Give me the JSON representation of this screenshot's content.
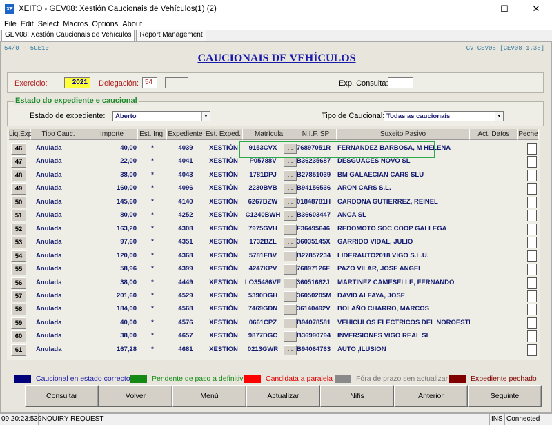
{
  "window": {
    "title": "XEITO - GEV08: Xestión Caucionais de Vehículos(1) (2)",
    "app_icon_text": "XE",
    "controls": {
      "minimize": "—",
      "maximize": "☐",
      "close": "✕"
    }
  },
  "menu": [
    "File",
    "Edit",
    "Select",
    "Macros",
    "Options",
    "About"
  ],
  "tabs": [
    "GEV08: Xestión Caucionais de Vehículos",
    "Report Management"
  ],
  "header": {
    "code_left": "54/0 - 5GE10",
    "code_right": "GV-GEV08 [GEV08 1.38]",
    "title": "CAUCIONAIS DE VEHÍCULOS"
  },
  "filters": {
    "exercicio_label": "Exercicio:",
    "exercicio_value": "2021",
    "delegacion_label": "Delegación:",
    "delegacion_value": "54",
    "delegacion_extra": "",
    "exp_consulta_label": "Exp. Consulta:",
    "exp_consulta_value": ""
  },
  "estado": {
    "legend": "Estado do expediente  e caucional",
    "estado_label": "Estado de expediente:",
    "estado_value": "Aberto",
    "tipo_label": "Tipo de Caucional:",
    "tipo_value": "Todas as caucionais"
  },
  "columns": [
    "Liq.Exp.",
    "Tipo Cauc.",
    "Importe",
    "Est. Ing.",
    "Expediente",
    "Est. Exped.",
    "Matrícula",
    "N.I.F. SP",
    "Suxeito Pasivo",
    "Act. Datos",
    "Peche"
  ],
  "rows": [
    {
      "n": "46",
      "tipo": "Anulada",
      "importe": "40,00",
      "est": "*",
      "exp": "4039",
      "estexp": "XESTIÓN",
      "mat": "9153CVX",
      "nif": "76897051R",
      "suxeito": "FERNANDEZ BARBOSA, M HELENA"
    },
    {
      "n": "47",
      "tipo": "Anulada",
      "importe": "22,00",
      "est": "*",
      "exp": "4041",
      "estexp": "XESTIÓN",
      "mat": "P05788V",
      "nif": "B36235687",
      "suxeito": "DESGUACES NOVO SL"
    },
    {
      "n": "48",
      "tipo": "Anulada",
      "importe": "38,00",
      "est": "*",
      "exp": "4043",
      "estexp": "XESTIÓN",
      "mat": "1781DPJ",
      "nif": "B27851039",
      "suxeito": "BM GALAECIAN CARS SLU"
    },
    {
      "n": "49",
      "tipo": "Anulada",
      "importe": "160,00",
      "est": "*",
      "exp": "4096",
      "estexp": "XESTIÓN",
      "mat": "2230BVB",
      "nif": "B94156536",
      "suxeito": "ARON CARS S.L."
    },
    {
      "n": "50",
      "tipo": "Anulada",
      "importe": "145,60",
      "est": "*",
      "exp": "4140",
      "estexp": "XESTIÓN",
      "mat": "6267BZW",
      "nif": "01848781H",
      "suxeito": "CARDONA GUTIERREZ, REINEL"
    },
    {
      "n": "51",
      "tipo": "Anulada",
      "importe": "80,00",
      "est": "*",
      "exp": "4252",
      "estexp": "XESTIÓN",
      "mat": "C1240BWH",
      "nif": "B36603447",
      "suxeito": "ANCA SL"
    },
    {
      "n": "52",
      "tipo": "Anulada",
      "importe": "163,20",
      "est": "*",
      "exp": "4308",
      "estexp": "XESTIÓN",
      "mat": "7975GVH",
      "nif": "F36495646",
      "suxeito": "REDOMOTO SOC COOP GALLEGA"
    },
    {
      "n": "53",
      "tipo": "Anulada",
      "importe": "97,60",
      "est": "*",
      "exp": "4351",
      "estexp": "XESTIÓN",
      "mat": "1732BZL",
      "nif": "36035145X",
      "suxeito": "GARRIDO VIDAL, JULIO"
    },
    {
      "n": "54",
      "tipo": "Anulada",
      "importe": "120,00",
      "est": "*",
      "exp": "4368",
      "estexp": "XESTIÓN",
      "mat": "5781FBV",
      "nif": "B27857234",
      "suxeito": "LIDERAUTO2018 VIGO S.L.U."
    },
    {
      "n": "55",
      "tipo": "Anulada",
      "importe": "58,96",
      "est": "*",
      "exp": "4399",
      "estexp": "XESTIÓN",
      "mat": "4247KPV",
      "nif": "76897126F",
      "suxeito": "PAZO VILAR, JOSE ANGEL"
    },
    {
      "n": "56",
      "tipo": "Anulada",
      "importe": "38,00",
      "est": "*",
      "exp": "4449",
      "estexp": "XESTIÓN",
      "mat": "LO35486VE",
      "nif": "36051662J",
      "suxeito": "MARTINEZ CAMESELLE, FERNANDO"
    },
    {
      "n": "57",
      "tipo": "Anulada",
      "importe": "201,60",
      "est": "*",
      "exp": "4529",
      "estexp": "XESTIÓN",
      "mat": "5390DGH",
      "nif": "36050205M",
      "suxeito": "DAVID ALFAYA, JOSE"
    },
    {
      "n": "58",
      "tipo": "Anulada",
      "importe": "184,00",
      "est": "*",
      "exp": "4568",
      "estexp": "XESTIÓN",
      "mat": "7469GDN",
      "nif": "36140492V",
      "suxeito": "BOLAÑO CHARRO, MARCOS"
    },
    {
      "n": "59",
      "tipo": "Anulada",
      "importe": "40,00",
      "est": "*",
      "exp": "4576",
      "estexp": "XESTIÓN",
      "mat": "0661CPZ",
      "nif": "B94078581",
      "suxeito": "VEHICULOS ELECTRICOS DEL NOROESTE S"
    },
    {
      "n": "60",
      "tipo": "Anulada",
      "importe": "38,00",
      "est": "*",
      "exp": "4657",
      "estexp": "XESTIÓN",
      "mat": "9877DGC",
      "nif": "B36990794",
      "suxeito": "INVERSIONES VIGO REAL SL"
    },
    {
      "n": "61",
      "tipo": "Anulada",
      "importe": "167,28",
      "est": "*",
      "exp": "4681",
      "estexp": "XESTIÓN",
      "mat": "0213GWR",
      "nif": "B94064763",
      "suxeito": "AUTO ,ILUSION"
    }
  ],
  "row_button_label": "...",
  "legend": [
    {
      "color": "#00007a",
      "label": "Caucional en estado correcto",
      "text_color": "#1a1aaa"
    },
    {
      "color": "#148a14",
      "label": "Pendente de paso a definitiva",
      "text_color": "#148a14"
    },
    {
      "color": "#ff0000",
      "label": "Candidata a paralela",
      "text_color": "#e00000"
    },
    {
      "color": "#8a8a8a",
      "label": "Fóra de prazo sen actualizar",
      "text_color": "#7a7a7a"
    },
    {
      "color": "#800000",
      "label": "Expediente pechado",
      "text_color": "#800000"
    }
  ],
  "buttons": [
    "Consultar",
    "Volver",
    "Menú",
    "Actualizar",
    "Nifis",
    "Anterior",
    "Seguinte"
  ],
  "status": {
    "time": "09:20:23:539",
    "request": "INQUIRY REQUEST",
    "ins": "INS",
    "connection": "Connected"
  }
}
